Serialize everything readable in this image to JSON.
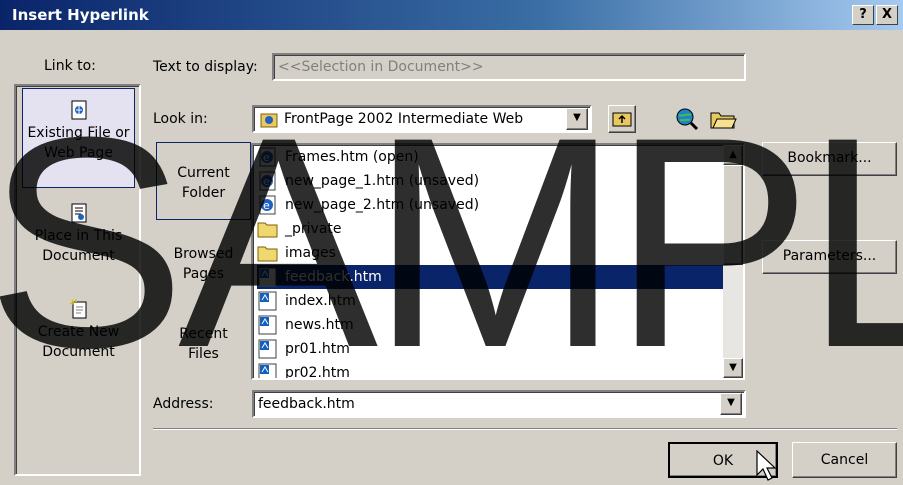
{
  "window": {
    "title": "Insert Hyperlink",
    "help_label": "?",
    "close_label": "X"
  },
  "left": {
    "heading": "Link to:",
    "items": [
      {
        "label_line1": "Existing File or",
        "label_line2": "Web Page",
        "icon": "document-globe-icon"
      },
      {
        "label_line1": "Place in This",
        "label_line2": "Document",
        "icon": "document-place-icon"
      },
      {
        "label_line1": "Create New",
        "label_line2": "Document",
        "icon": "new-document-icon"
      }
    ]
  },
  "text_to_display": {
    "label": "Text to display:",
    "value": "<<Selection in Document>>"
  },
  "look_in": {
    "label": "Look in:",
    "value": "FrontPage 2002 Intermediate Web"
  },
  "tabs": [
    {
      "line1": "Current",
      "line2": "Folder"
    },
    {
      "line1": "Browsed",
      "line2": "Pages"
    },
    {
      "line1": "Recent",
      "line2": "Files"
    }
  ],
  "files": [
    {
      "name": "Frames.htm (open)",
      "icon": "web-page-icon"
    },
    {
      "name": "new_page_1.htm (unsaved)",
      "icon": "web-page-icon"
    },
    {
      "name": "new_page_2.htm (unsaved)",
      "icon": "web-page-icon"
    },
    {
      "name": "_private",
      "icon": "folder-icon"
    },
    {
      "name": "images",
      "icon": "folder-icon"
    },
    {
      "name": "feedback.htm",
      "icon": "frontpage-file-icon",
      "selected": true
    },
    {
      "name": "index.htm",
      "icon": "frontpage-file-icon"
    },
    {
      "name": "news.htm",
      "icon": "frontpage-file-icon"
    },
    {
      "name": "pr01.htm",
      "icon": "frontpage-file-icon"
    },
    {
      "name": "pr02.htm",
      "icon": "frontpage-file-icon"
    }
  ],
  "buttons": {
    "bookmark": "Bookmark...",
    "parameters": "Parameters...",
    "ok": "OK",
    "cancel": "Cancel"
  },
  "address": {
    "label": "Address:",
    "value": "feedback.htm"
  },
  "watermark": "SAMPLE",
  "colors": {
    "titlebar": "#0a246a",
    "selection": "#0a246a",
    "dialog": "#d4d0c8"
  }
}
